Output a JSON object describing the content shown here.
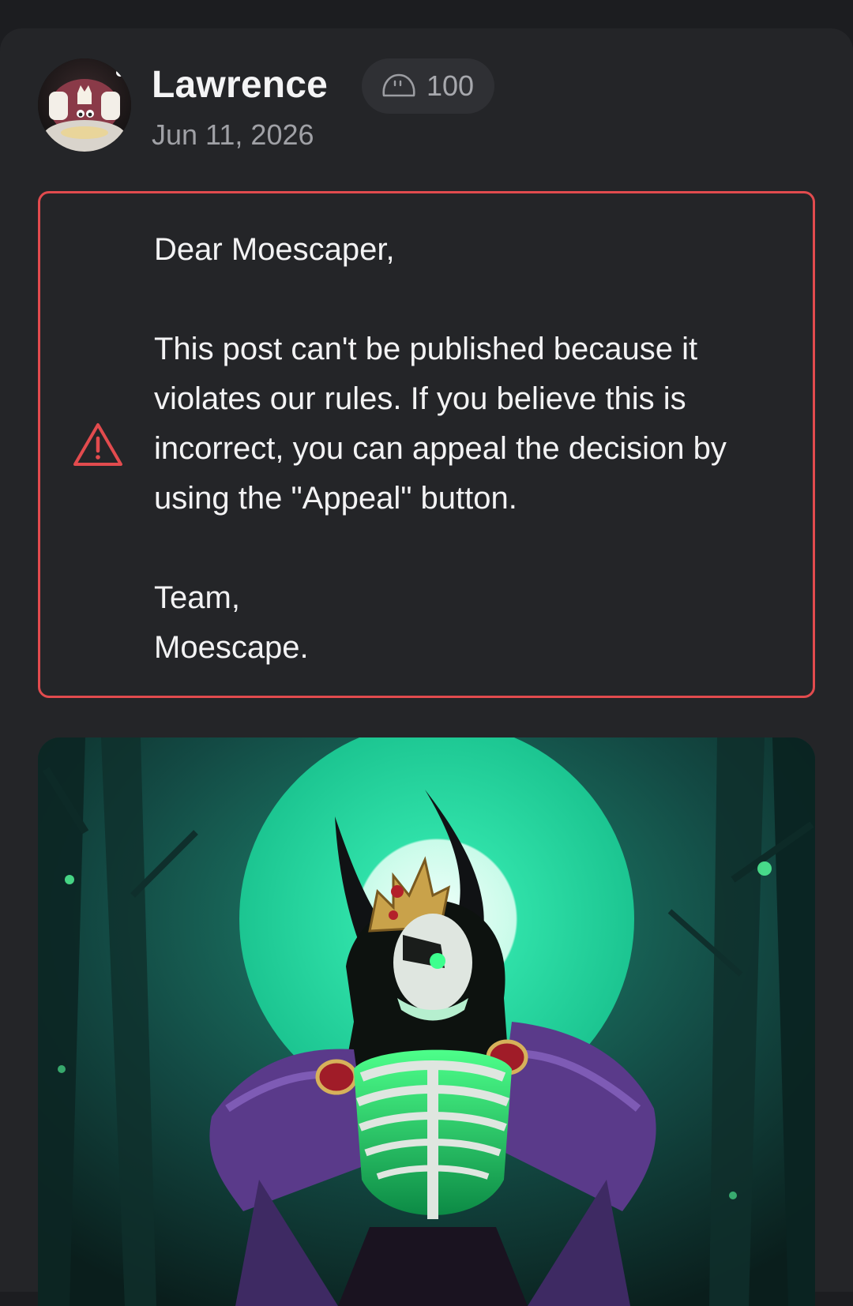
{
  "post": {
    "author": "Lawrence",
    "credits": "100",
    "date": "Jun 11, 2026"
  },
  "notice": {
    "greeting": "Dear Moescaper,",
    "body": "This post can't be published because it violates our rules. If you believe this is incorrect, you can appeal the decision by using the \"Appeal\" button.",
    "signoff_line1": "Team,",
    "signoff_line2": "Moescape."
  },
  "icons": {
    "credits": "bubble-icon",
    "warning": "warning-triangle-icon"
  },
  "colors": {
    "alert_border": "#e24b4e",
    "card_background": "#242528",
    "page_background": "#1c1d20",
    "image_glow": "#29d9a0"
  }
}
